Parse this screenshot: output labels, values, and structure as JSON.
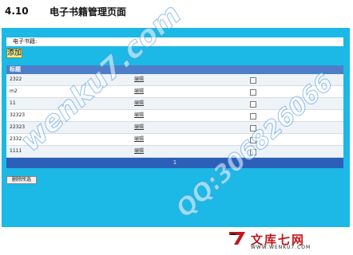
{
  "document": {
    "section_number": "4.10",
    "section_title": "电子书籍管理页面"
  },
  "form": {
    "name_label": "电子书籍:",
    "add_label": "添加"
  },
  "table": {
    "header_title": "标题",
    "rows": [
      {
        "title": "2322",
        "action": "编辑",
        "checked": false
      },
      {
        "title": "m2",
        "action": "编辑",
        "checked": false
      },
      {
        "title": "11",
        "action": "编辑",
        "checked": false
      },
      {
        "title": "32323",
        "action": "编辑",
        "checked": false
      },
      {
        "title": "22323",
        "action": "编辑",
        "checked": false
      },
      {
        "title": "2332",
        "action": "编辑",
        "checked": false
      },
      {
        "title": "1111",
        "action": "编辑",
        "checked": false
      }
    ],
    "current_page": "1"
  },
  "actions": {
    "delete_selected_label": "删除所选"
  },
  "watermarks": {
    "site": "wenku7.com",
    "qq": "QQ:306826066"
  },
  "footer_logo": {
    "name": "文库七网",
    "url": "WWW.WENKU7.COM",
    "mark_icon": "seven-logo-icon"
  },
  "colors": {
    "panel": "#1cb8e6",
    "header": "#4f7ec8",
    "pager": "#2c5fb8",
    "logo_red": "#c0181c"
  }
}
